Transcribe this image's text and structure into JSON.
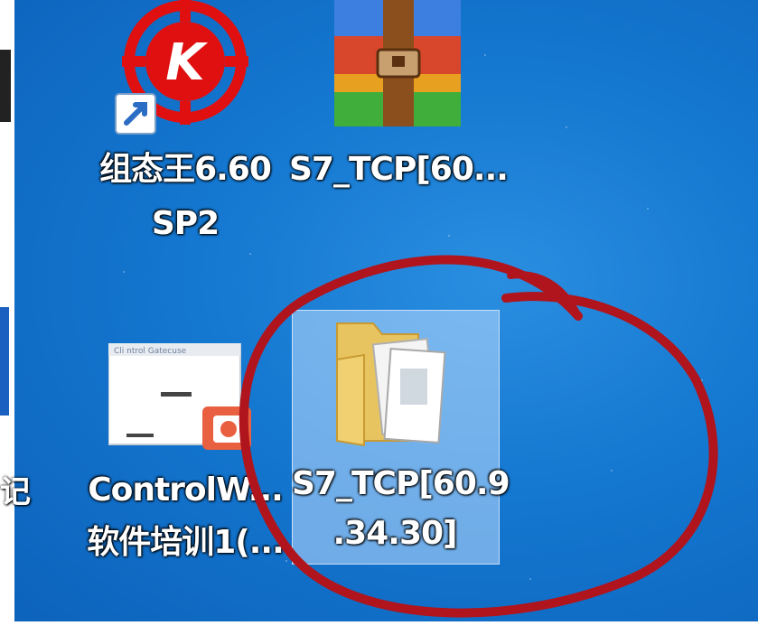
{
  "desktop": {
    "icons": [
      {
        "id": "kingview",
        "label_line1": "组态王6.60",
        "label_line2": "SP2",
        "icon": "kingview-k-crosshair-icon",
        "shortcut": true
      },
      {
        "id": "winrar",
        "label_line1": "S7_TCP[60...",
        "icon": "winrar-archive-icon"
      },
      {
        "id": "controlwin",
        "label_line1": "ControlW...",
        "label_line2": "软件培训1(...",
        "icon": "controlwin-document-icon"
      },
      {
        "id": "folder",
        "label_line1": "S7_TCP[60.9",
        "label_line2": ".34.30]",
        "icon": "folder-icon",
        "selected": true
      }
    ],
    "left_edge_label": "记"
  },
  "colors": {
    "desktop_bg": "#1477d0",
    "annotation_circle": "#b0141c",
    "selection": "#bedcff"
  }
}
